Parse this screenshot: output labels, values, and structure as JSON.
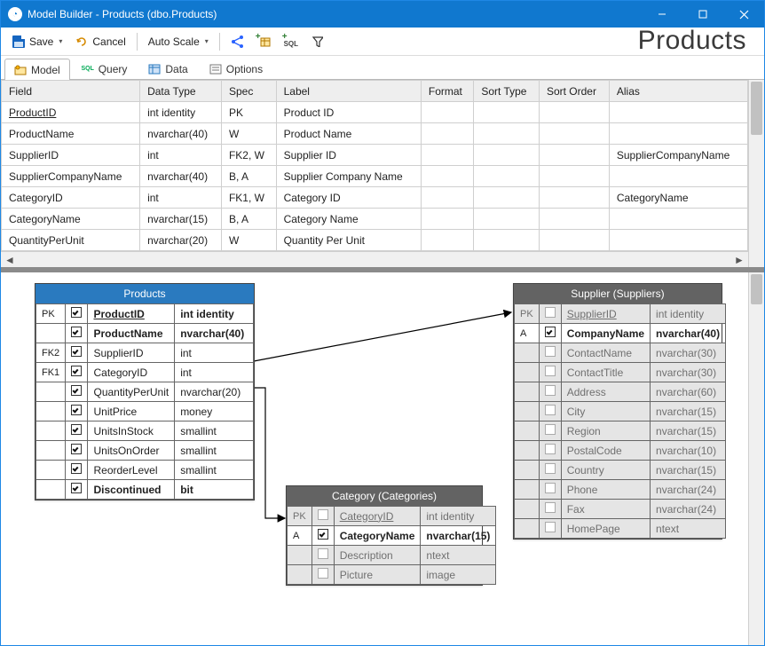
{
  "window": {
    "title": "Model Builder - Products (dbo.Products)"
  },
  "page_heading": "Products",
  "toolbar": {
    "save": "Save",
    "cancel": "Cancel",
    "autoscale": "Auto Scale"
  },
  "tabs": [
    {
      "label": "Model",
      "active": true
    },
    {
      "label": "Query",
      "active": false
    },
    {
      "label": "Data",
      "active": false
    },
    {
      "label": "Options",
      "active": false
    }
  ],
  "grid": {
    "headers": [
      "Field",
      "Data Type",
      "Spec",
      "Label",
      "Format",
      "Sort Type",
      "Sort Order",
      "Alias"
    ],
    "rows": [
      {
        "field": "ProductID",
        "bold": true,
        "underline": true,
        "type": "int identity",
        "spec": "PK",
        "label": "Product ID",
        "format": "",
        "sortType": "",
        "sortOrder": "",
        "alias": ""
      },
      {
        "field": "ProductName",
        "bold": true,
        "type": "nvarchar(40)",
        "spec": "W",
        "label": "Product Name",
        "format": "",
        "sortType": "",
        "sortOrder": "",
        "alias": ""
      },
      {
        "field": "SupplierID",
        "type": "int",
        "spec": "FK2, W",
        "label": "Supplier ID",
        "format": "",
        "sortType": "",
        "sortOrder": "",
        "alias": "SupplierCompanyName"
      },
      {
        "field": "SupplierCompanyName",
        "type": "nvarchar(40)",
        "spec": "B, A",
        "label": "Supplier Company Name",
        "format": "",
        "sortType": "",
        "sortOrder": "",
        "alias": ""
      },
      {
        "field": "CategoryID",
        "type": "int",
        "spec": "FK1, W",
        "label": "Category ID",
        "format": "",
        "sortType": "",
        "sortOrder": "",
        "alias": "CategoryName"
      },
      {
        "field": "CategoryName",
        "type": "nvarchar(15)",
        "spec": "B, A",
        "label": "Category Name",
        "format": "",
        "sortType": "",
        "sortOrder": "",
        "alias": ""
      },
      {
        "field": "QuantityPerUnit",
        "type": "nvarchar(20)",
        "spec": "W",
        "label": "Quantity Per Unit",
        "format": "",
        "sortType": "",
        "sortOrder": "",
        "alias": ""
      }
    ]
  },
  "diagram": {
    "products": {
      "title": "Products",
      "rows": [
        {
          "key": "PK",
          "checked": true,
          "name": "ProductID",
          "type": "int identity",
          "bold": true,
          "underline": true
        },
        {
          "key": "",
          "checked": true,
          "name": "ProductName",
          "type": "nvarchar(40)",
          "bold": true
        },
        {
          "key": "FK2",
          "checked": true,
          "name": "SupplierID",
          "type": "int"
        },
        {
          "key": "FK1",
          "checked": true,
          "name": "CategoryID",
          "type": "int"
        },
        {
          "key": "",
          "checked": true,
          "name": "QuantityPerUnit",
          "type": "nvarchar(20)"
        },
        {
          "key": "",
          "checked": true,
          "name": "UnitPrice",
          "type": "money"
        },
        {
          "key": "",
          "checked": true,
          "name": "UnitsInStock",
          "type": "smallint"
        },
        {
          "key": "",
          "checked": true,
          "name": "UnitsOnOrder",
          "type": "smallint"
        },
        {
          "key": "",
          "checked": true,
          "name": "ReorderLevel",
          "type": "smallint"
        },
        {
          "key": "",
          "checked": true,
          "name": "Discontinued",
          "type": "bit",
          "bold": true
        }
      ]
    },
    "supplier": {
      "title": "Supplier (Suppliers)",
      "rows": [
        {
          "key": "PK",
          "checked": false,
          "name": "SupplierID",
          "type": "int identity",
          "underline": true,
          "dim": true
        },
        {
          "key": "A",
          "checked": true,
          "name": "CompanyName",
          "type": "nvarchar(40)",
          "bold": true
        },
        {
          "key": "",
          "checked": false,
          "name": "ContactName",
          "type": "nvarchar(30)",
          "dim": true
        },
        {
          "key": "",
          "checked": false,
          "name": "ContactTitle",
          "type": "nvarchar(30)",
          "dim": true
        },
        {
          "key": "",
          "checked": false,
          "name": "Address",
          "type": "nvarchar(60)",
          "dim": true
        },
        {
          "key": "",
          "checked": false,
          "name": "City",
          "type": "nvarchar(15)",
          "dim": true
        },
        {
          "key": "",
          "checked": false,
          "name": "Region",
          "type": "nvarchar(15)",
          "dim": true
        },
        {
          "key": "",
          "checked": false,
          "name": "PostalCode",
          "type": "nvarchar(10)",
          "dim": true
        },
        {
          "key": "",
          "checked": false,
          "name": "Country",
          "type": "nvarchar(15)",
          "dim": true
        },
        {
          "key": "",
          "checked": false,
          "name": "Phone",
          "type": "nvarchar(24)",
          "dim": true
        },
        {
          "key": "",
          "checked": false,
          "name": "Fax",
          "type": "nvarchar(24)",
          "dim": true
        },
        {
          "key": "",
          "checked": false,
          "name": "HomePage",
          "type": "ntext",
          "dim": true
        }
      ]
    },
    "category": {
      "title": "Category (Categories)",
      "rows": [
        {
          "key": "PK",
          "checked": false,
          "name": "CategoryID",
          "type": "int identity",
          "underline": true,
          "dim": true
        },
        {
          "key": "A",
          "checked": true,
          "name": "CategoryName",
          "type": "nvarchar(15)",
          "bold": true
        },
        {
          "key": "",
          "checked": false,
          "name": "Description",
          "type": "ntext",
          "dim": true
        },
        {
          "key": "",
          "checked": false,
          "name": "Picture",
          "type": "image",
          "dim": true
        }
      ]
    }
  }
}
